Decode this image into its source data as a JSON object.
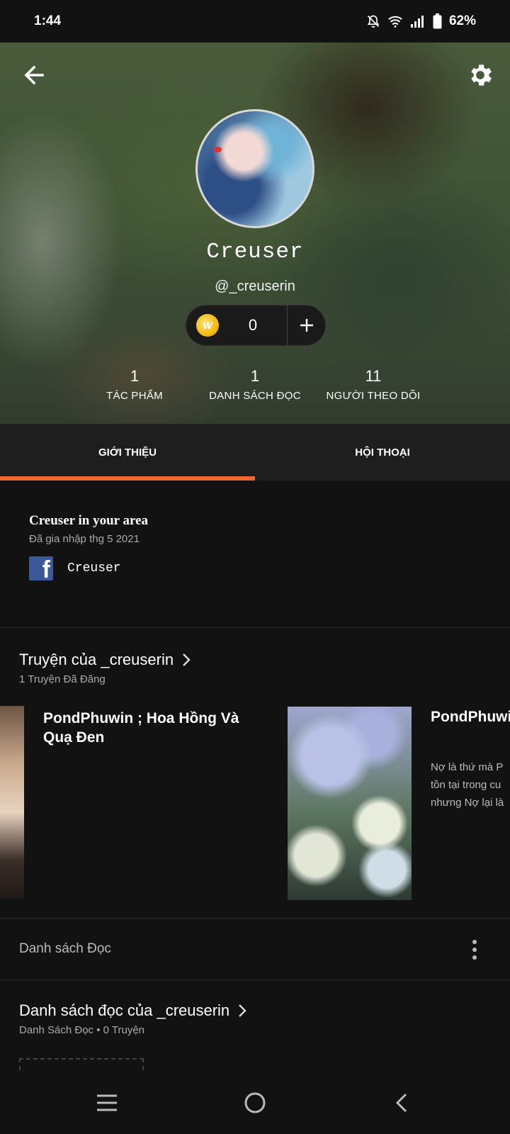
{
  "status": {
    "time": "1:44",
    "battery": "62%"
  },
  "profile": {
    "display_name": "Creuser",
    "username": "@_creuserin",
    "coins": "0",
    "stats": [
      {
        "value": "1",
        "label": "TÁC PHẨM"
      },
      {
        "value": "1",
        "label": "DANH SÁCH ĐỌC"
      },
      {
        "value": "11",
        "label": "NGƯỜI THEO DÕI"
      }
    ]
  },
  "tabs": [
    {
      "label": "GIỚI THIỆU"
    },
    {
      "label": "HỘI THOẠI"
    }
  ],
  "about": {
    "title": "Creuser in your area",
    "joined": "Đã gia nhập thg 5 2021",
    "facebook_name": "Creuser"
  },
  "stories_section": {
    "title": "Truyện của _creuserin",
    "subtitle": "1 Truyện Đã Đăng",
    "items": [
      {
        "title": "PondPhuwin ; Hoa Hồng Và Quạ Đen"
      },
      {
        "title": "PondPhuwin ; Hoa Hồng Và Quạ Đen",
        "desc": "Nợ là thứ mà P\ntồn tại trong cu\nnhưng Nợ lại là"
      }
    ]
  },
  "reading_list": {
    "label": "Danh sách Đọc",
    "title": "Danh sách đọc của _creuserin",
    "subtitle": "Danh Sách Đọc • 0 Truyện"
  }
}
